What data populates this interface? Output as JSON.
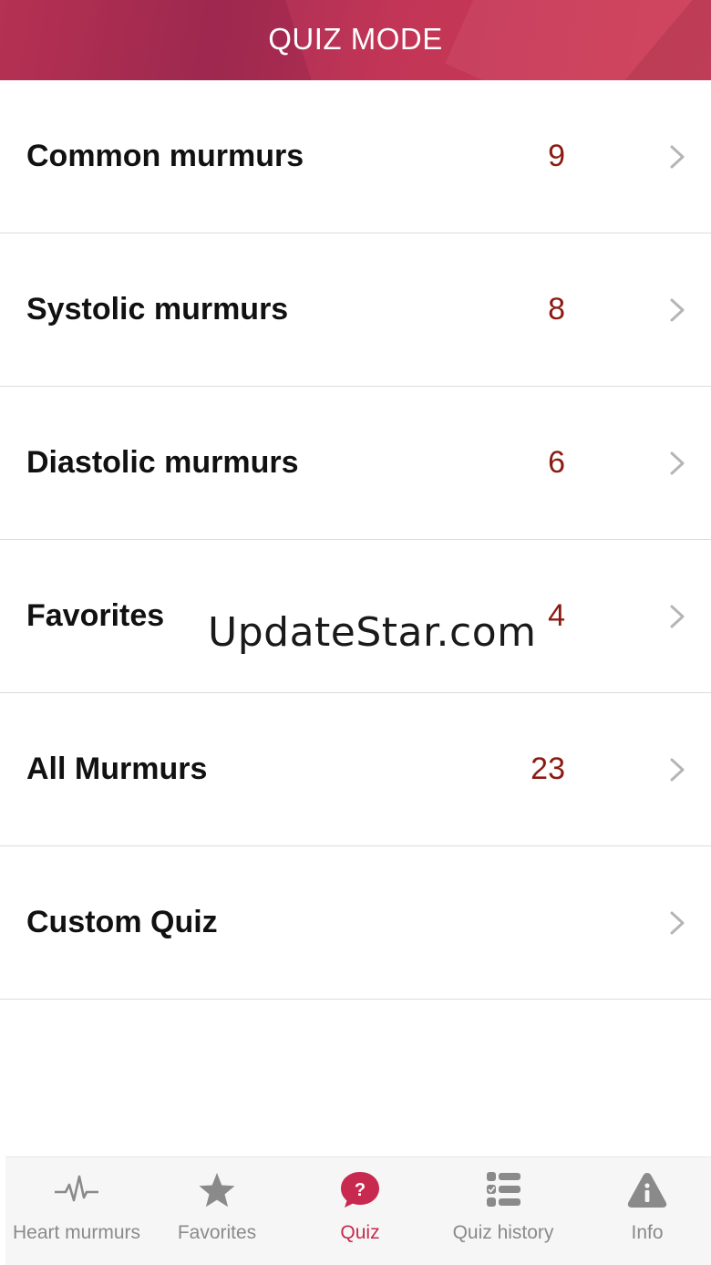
{
  "header": {
    "title": "QUIZ MODE"
  },
  "rows": [
    {
      "label": "Common murmurs",
      "count": "9"
    },
    {
      "label": "Systolic murmurs",
      "count": "8"
    },
    {
      "label": "Diastolic murmurs",
      "count": "6"
    },
    {
      "label": "Favorites",
      "count": "4"
    },
    {
      "label": "All Murmurs",
      "count": "23"
    },
    {
      "label": "Custom Quiz",
      "count": ""
    }
  ],
  "watermark": "UpdateStar.com",
  "tabbar": {
    "active": "Quiz",
    "tabs": [
      {
        "label": "Heart murmurs",
        "icon": "heartbeat-icon"
      },
      {
        "label": "Favorites",
        "icon": "star-icon"
      },
      {
        "label": "Quiz",
        "icon": "question-bubble-icon"
      },
      {
        "label": "Quiz history",
        "icon": "checklist-icon"
      },
      {
        "label": "Info",
        "icon": "info-triangle-icon"
      }
    ]
  },
  "colors": {
    "header_bg": "#c23556",
    "count_text": "#8b1a12",
    "active_tab": "#c7294f",
    "inactive_tab": "#8a8a8a"
  }
}
